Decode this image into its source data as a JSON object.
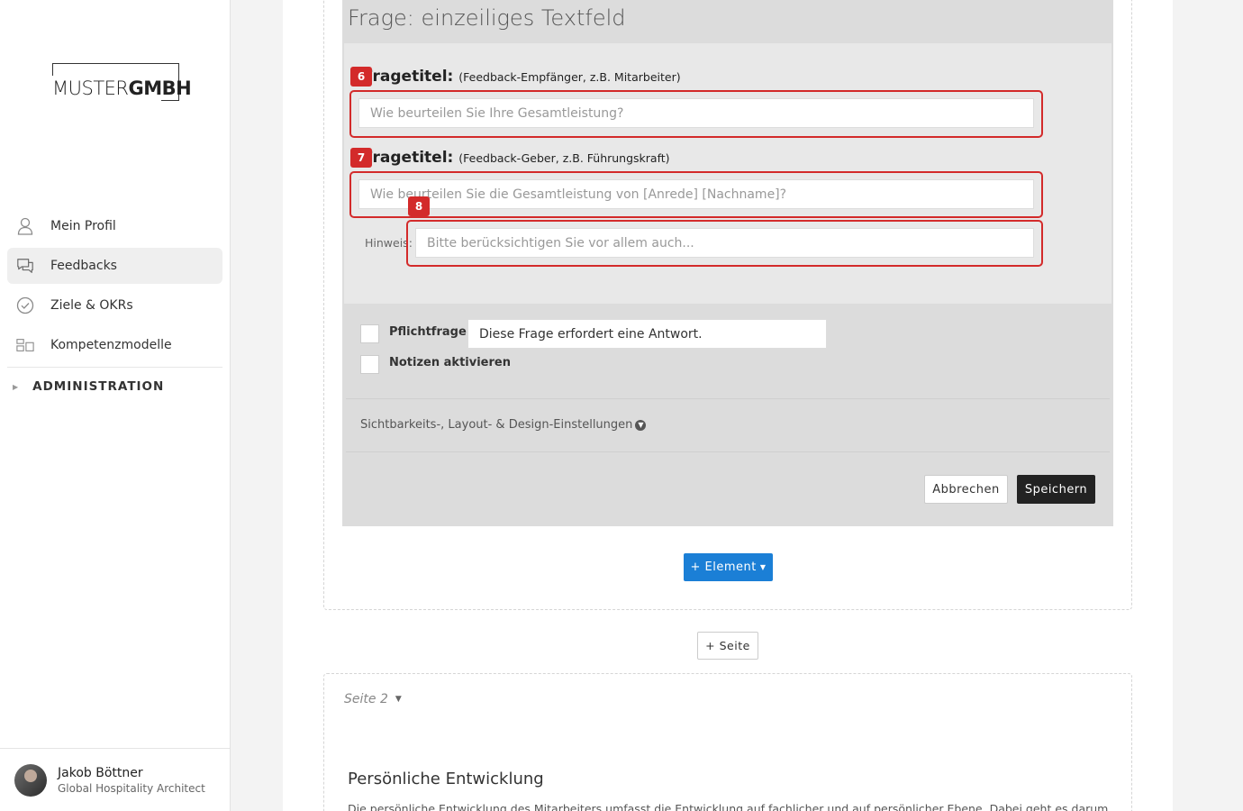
{
  "sidebar": {
    "logo": {
      "part1": "MUSTER",
      "part2": "GMBH"
    },
    "nav": [
      {
        "label": "Mein Profil",
        "icon": "user-icon"
      },
      {
        "label": "Feedbacks",
        "icon": "chat-bubbles-icon",
        "active": true
      },
      {
        "label": "Ziele & OKRs",
        "icon": "check-circle-icon"
      },
      {
        "label": "Kompetenzmodelle",
        "icon": "grid-blocks-icon"
      }
    ],
    "admin_label": "ADMINISTRATION",
    "user": {
      "name": "Jakob Böttner",
      "role": "Global Hospitality Architect"
    }
  },
  "question": {
    "header": "Frage: einzeiliges Textfeld",
    "label1": {
      "title": "Fragetitel:",
      "sub": "(Feedback-Empfänger, z.B. Mitarbeiter)"
    },
    "input1_placeholder": "Wie beurteilen Sie Ihre Gesamtleistung?",
    "label2": {
      "title": "Fragetitel:",
      "sub": "(Feedback-Geber, z.B. Führungskraft)"
    },
    "input2_placeholder": "Wie beurteilen Sie die Gesamtleistung von [Anrede] [Nachname]?",
    "hint_label": "Hinweis:",
    "hint_placeholder": "Bitte berücksichtigen Sie vor allem auch...",
    "badges": [
      "6",
      "7",
      "8"
    ],
    "required_label": "Pflichtfrage",
    "required_text": "Diese Frage erfordert eine Antwort.",
    "notes_label": "Notizen aktivieren",
    "settings_link": "Sichtbarkeits-, Layout- & Design-Einstellungen",
    "cancel_label": "Abbrechen",
    "save_label": "Speichern"
  },
  "add_element_label": "+ Element",
  "add_page_label": "+ Seite",
  "page2": {
    "label": "Seite 2",
    "section_title": "Persönliche Entwicklung",
    "section_desc": "Die persönliche Entwicklung des Mitarbeiters umfasst die Entwicklung auf fachlicher und auf persönlicher Ebene. Dabei geht es darum, wie der"
  },
  "colors": {
    "accent_blue": "#1b7fd6",
    "highlight_red": "#d32a2a",
    "save_dark": "#222222"
  }
}
